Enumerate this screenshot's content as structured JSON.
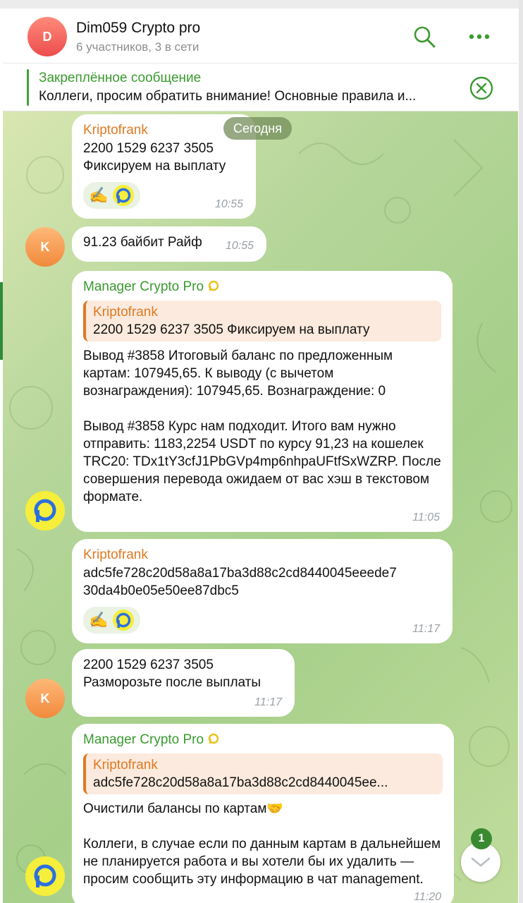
{
  "header": {
    "avatar_letter": "D",
    "title": "Dim059 Crypto pro",
    "subtitle": "6 участников, 3 в сети",
    "search_icon": "search-icon",
    "more_icon": "more-icon"
  },
  "pinned": {
    "title": "Закреплённое сообщение",
    "text": "Коллеги, просим обратить внимание! Основные правила и..."
  },
  "date_pill": "Сегодня",
  "messages": [
    {
      "sender": "Kriptofrank",
      "text": "2200 1529 6237 3505\nФиксируем на выплату",
      "reactions": [
        "✍️",
        "manager-logo"
      ],
      "time": "10:55"
    },
    {
      "avatar_letter": "K",
      "text": "91.23 байбит Райф",
      "time": "10:55"
    },
    {
      "sender": "Manager Crypto Pro",
      "quote_sender": "Kriptofrank",
      "quote_text": "2200 1529 6237 3505 Фиксируем на выплату",
      "text": "Вывод #3858 Итоговый баланс по предложенным картам: 107945,65. К выводу (с вычетом вознаграждения): 107945,65. Вознаграждение: 0\n\nВывод #3858 Курс нам подходит. Итого вам нужно отправить: 1183,2254 USDT по курсу 91,23 на кошелек TRC20: TDx1tY3cfJ1PbGVp4mp6nhpaUFtfSxWZRP. После совершения перевода ожидаем от вас хэш в текстовом формате.",
      "time": "11:05"
    },
    {
      "sender": "Kriptofrank",
      "text": "adc5fe728c20d58a8a17ba3d88c2cd8440045eeede7\n30da4b0e05e50ee87dbc5",
      "reactions": [
        "✍️",
        "manager-logo"
      ],
      "time": "11:17"
    },
    {
      "avatar_letter": "K",
      "text": "2200 1529 6237 3505\nРазморозьте после выплаты",
      "time": "11:17"
    },
    {
      "sender": "Manager Crypto Pro",
      "quote_sender": "Kriptofrank",
      "quote_text": "adc5fe728c20d58a8a17ba3d88c2cd8440045ee...",
      "text": "Очистили балансы по картам🤝\n\nКоллеги, в случае если по данным картам в дальнейшем не планируется работа и вы хотели бы их удалить — просим сообщить эту информацию в чат management.",
      "time": "11:20"
    }
  ],
  "scroll_down": {
    "unread_count": "1",
    "icon": "chevron-down-icon"
  },
  "colors": {
    "accent_green": "#3a9a2f",
    "sender_orange": "#e07a23",
    "manager_logo_yellow": "#f5ee3a",
    "manager_logo_blue": "#2b6fe0"
  }
}
